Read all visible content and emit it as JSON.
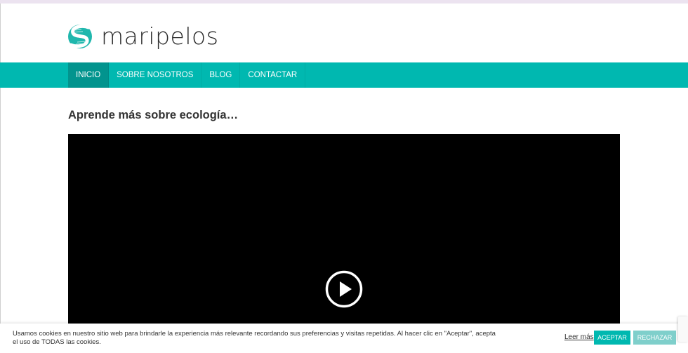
{
  "site": {
    "name": "maripelos",
    "logo_icon": "leaf-s-logo-icon",
    "brand_color": "#00b8b0"
  },
  "nav": {
    "items": [
      {
        "label": "INICIO",
        "active": true
      },
      {
        "label": "SOBRE NOSOTROS",
        "active": false
      },
      {
        "label": "BLOG",
        "active": false
      },
      {
        "label": "CONTACTAR",
        "active": false
      }
    ]
  },
  "main": {
    "title": "Aprende más sobre ecología…",
    "video": {
      "play_icon": "play-icon"
    }
  },
  "cookie": {
    "text": "Usamos cookies en nuestro sitio web para brindarle la experiencia más relevante recordando sus preferencias y visitas repetidas. Al hacer clic en \"Aceptar\", acepta el uso de TODAS las cookies.",
    "more_label": "Leer más",
    "accept_label": "ACEPTAR",
    "reject_label": "RECHAZAR"
  }
}
